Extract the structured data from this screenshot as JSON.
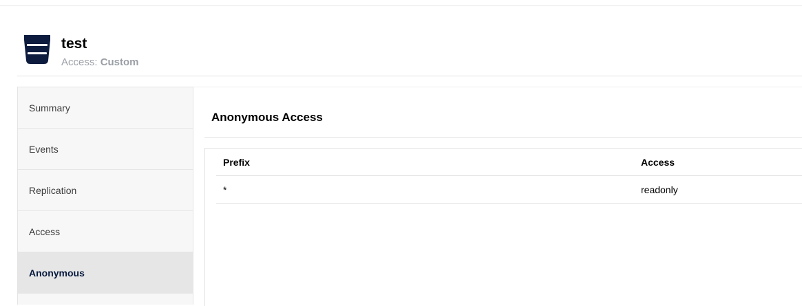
{
  "bucket": {
    "name": "test",
    "access_label": "Access:",
    "access_value": "Custom",
    "icon": "bucket-icon",
    "icon_color": "#0d1b3e"
  },
  "sidebar": {
    "items": [
      {
        "label": "Summary"
      },
      {
        "label": "Events"
      },
      {
        "label": "Replication"
      },
      {
        "label": "Access"
      },
      {
        "label": "Anonymous"
      }
    ],
    "active_item": "Anonymous"
  },
  "main": {
    "title": "Anonymous Access",
    "table": {
      "columns": [
        "Prefix",
        "Access"
      ],
      "rows": [
        [
          "*",
          "readonly"
        ]
      ]
    }
  },
  "colors": {
    "sidebar_bg": "#f7f7f7",
    "active_bg": "#e6e6e6",
    "active_text": "#07193e",
    "muted_text": "#9a9ea5"
  }
}
